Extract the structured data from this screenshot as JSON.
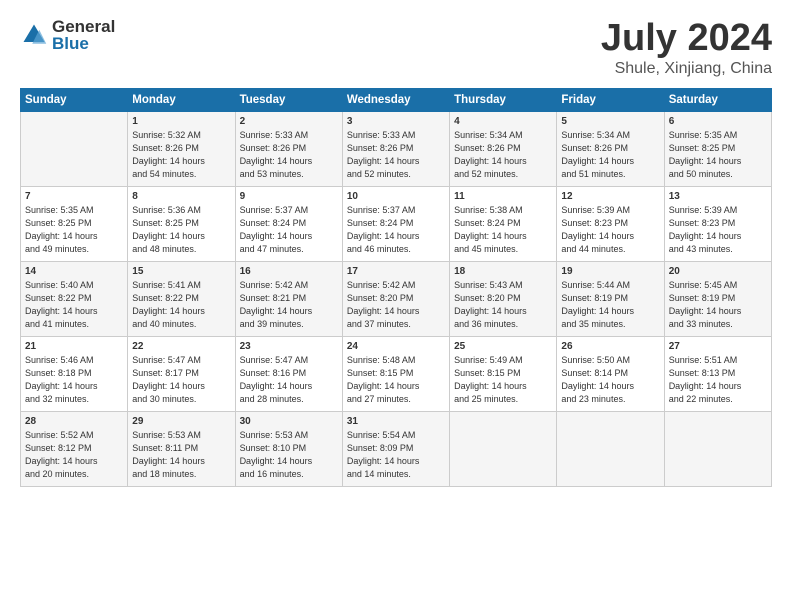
{
  "logo": {
    "general": "General",
    "blue": "Blue"
  },
  "title": "July 2024",
  "subtitle": "Shule, Xinjiang, China",
  "days": [
    "Sunday",
    "Monday",
    "Tuesday",
    "Wednesday",
    "Thursday",
    "Friday",
    "Saturday"
  ],
  "weeks": [
    [
      {
        "day": "",
        "info": ""
      },
      {
        "day": "1",
        "info": "Sunrise: 5:32 AM\nSunset: 8:26 PM\nDaylight: 14 hours\nand 54 minutes."
      },
      {
        "day": "2",
        "info": "Sunrise: 5:33 AM\nSunset: 8:26 PM\nDaylight: 14 hours\nand 53 minutes."
      },
      {
        "day": "3",
        "info": "Sunrise: 5:33 AM\nSunset: 8:26 PM\nDaylight: 14 hours\nand 52 minutes."
      },
      {
        "day": "4",
        "info": "Sunrise: 5:34 AM\nSunset: 8:26 PM\nDaylight: 14 hours\nand 52 minutes."
      },
      {
        "day": "5",
        "info": "Sunrise: 5:34 AM\nSunset: 8:26 PM\nDaylight: 14 hours\nand 51 minutes."
      },
      {
        "day": "6",
        "info": "Sunrise: 5:35 AM\nSunset: 8:25 PM\nDaylight: 14 hours\nand 50 minutes."
      }
    ],
    [
      {
        "day": "7",
        "info": "Sunrise: 5:35 AM\nSunset: 8:25 PM\nDaylight: 14 hours\nand 49 minutes."
      },
      {
        "day": "8",
        "info": "Sunrise: 5:36 AM\nSunset: 8:25 PM\nDaylight: 14 hours\nand 48 minutes."
      },
      {
        "day": "9",
        "info": "Sunrise: 5:37 AM\nSunset: 8:24 PM\nDaylight: 14 hours\nand 47 minutes."
      },
      {
        "day": "10",
        "info": "Sunrise: 5:37 AM\nSunset: 8:24 PM\nDaylight: 14 hours\nand 46 minutes."
      },
      {
        "day": "11",
        "info": "Sunrise: 5:38 AM\nSunset: 8:24 PM\nDaylight: 14 hours\nand 45 minutes."
      },
      {
        "day": "12",
        "info": "Sunrise: 5:39 AM\nSunset: 8:23 PM\nDaylight: 14 hours\nand 44 minutes."
      },
      {
        "day": "13",
        "info": "Sunrise: 5:39 AM\nSunset: 8:23 PM\nDaylight: 14 hours\nand 43 minutes."
      }
    ],
    [
      {
        "day": "14",
        "info": "Sunrise: 5:40 AM\nSunset: 8:22 PM\nDaylight: 14 hours\nand 41 minutes."
      },
      {
        "day": "15",
        "info": "Sunrise: 5:41 AM\nSunset: 8:22 PM\nDaylight: 14 hours\nand 40 minutes."
      },
      {
        "day": "16",
        "info": "Sunrise: 5:42 AM\nSunset: 8:21 PM\nDaylight: 14 hours\nand 39 minutes."
      },
      {
        "day": "17",
        "info": "Sunrise: 5:42 AM\nSunset: 8:20 PM\nDaylight: 14 hours\nand 37 minutes."
      },
      {
        "day": "18",
        "info": "Sunrise: 5:43 AM\nSunset: 8:20 PM\nDaylight: 14 hours\nand 36 minutes."
      },
      {
        "day": "19",
        "info": "Sunrise: 5:44 AM\nSunset: 8:19 PM\nDaylight: 14 hours\nand 35 minutes."
      },
      {
        "day": "20",
        "info": "Sunrise: 5:45 AM\nSunset: 8:19 PM\nDaylight: 14 hours\nand 33 minutes."
      }
    ],
    [
      {
        "day": "21",
        "info": "Sunrise: 5:46 AM\nSunset: 8:18 PM\nDaylight: 14 hours\nand 32 minutes."
      },
      {
        "day": "22",
        "info": "Sunrise: 5:47 AM\nSunset: 8:17 PM\nDaylight: 14 hours\nand 30 minutes."
      },
      {
        "day": "23",
        "info": "Sunrise: 5:47 AM\nSunset: 8:16 PM\nDaylight: 14 hours\nand 28 minutes."
      },
      {
        "day": "24",
        "info": "Sunrise: 5:48 AM\nSunset: 8:15 PM\nDaylight: 14 hours\nand 27 minutes."
      },
      {
        "day": "25",
        "info": "Sunrise: 5:49 AM\nSunset: 8:15 PM\nDaylight: 14 hours\nand 25 minutes."
      },
      {
        "day": "26",
        "info": "Sunrise: 5:50 AM\nSunset: 8:14 PM\nDaylight: 14 hours\nand 23 minutes."
      },
      {
        "day": "27",
        "info": "Sunrise: 5:51 AM\nSunset: 8:13 PM\nDaylight: 14 hours\nand 22 minutes."
      }
    ],
    [
      {
        "day": "28",
        "info": "Sunrise: 5:52 AM\nSunset: 8:12 PM\nDaylight: 14 hours\nand 20 minutes."
      },
      {
        "day": "29",
        "info": "Sunrise: 5:53 AM\nSunset: 8:11 PM\nDaylight: 14 hours\nand 18 minutes."
      },
      {
        "day": "30",
        "info": "Sunrise: 5:53 AM\nSunset: 8:10 PM\nDaylight: 14 hours\nand 16 minutes."
      },
      {
        "day": "31",
        "info": "Sunrise: 5:54 AM\nSunset: 8:09 PM\nDaylight: 14 hours\nand 14 minutes."
      },
      {
        "day": "",
        "info": ""
      },
      {
        "day": "",
        "info": ""
      },
      {
        "day": "",
        "info": ""
      }
    ]
  ]
}
